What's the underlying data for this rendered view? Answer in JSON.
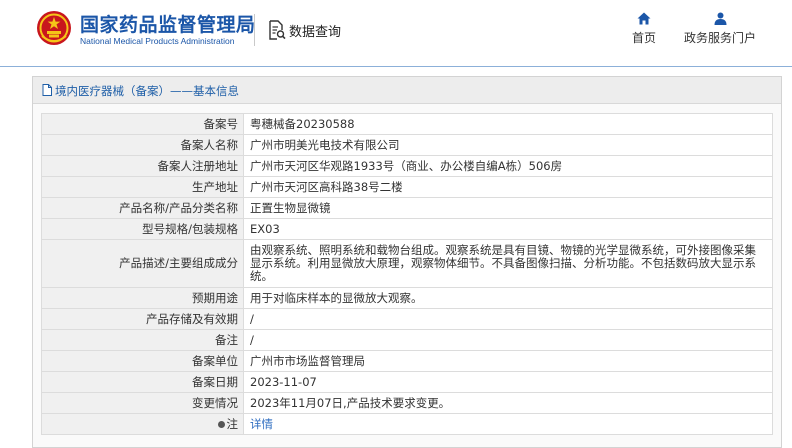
{
  "header": {
    "org_name_cn": "国家药品监督管理局",
    "org_name_en": "National Medical Products Administration",
    "data_query_label": "数据查询",
    "nav": {
      "home_label": "首页",
      "service_label": "政务服务门户"
    },
    "icons": {
      "emblem": "national-emblem-icon",
      "data_query": "document-search-icon",
      "home": "home-icon",
      "service": "user-icon"
    },
    "colors": {
      "brand_blue": "#1b56a8",
      "link_blue": "#2d6cc0"
    }
  },
  "panel": {
    "title": "境内医疗器械（备案）——基本信息",
    "title_icon": "document-icon"
  },
  "record": {
    "rows": [
      {
        "label": "备案号",
        "value": "粤穗械备20230588"
      },
      {
        "label": "备案人名称",
        "value": "广州市明美光电技术有限公司"
      },
      {
        "label": "备案人注册地址",
        "value": "广州市天河区华观路1933号（商业、办公楼自编A栋）506房"
      },
      {
        "label": "生产地址",
        "value": "广州市天河区高科路38号二楼"
      },
      {
        "label": "产品名称/产品分类名称",
        "value": "正置生物显微镜"
      },
      {
        "label": "型号规格/包装规格",
        "value": "EX03"
      },
      {
        "label": "产品描述/主要组成成分",
        "value": "由观察系统、照明系统和载物台组成。观察系统是具有目镜、物镜的光学显微系统，可外接图像采集显示系统。利用显微放大原理，观察物体细节。不具备图像扫描、分析功能。不包括数码放大显示系统。"
      },
      {
        "label": "预期用途",
        "value": "用于对临床样本的显微放大观察。"
      },
      {
        "label": "产品存储及有效期",
        "value": "/"
      },
      {
        "label": "备注",
        "value": "/"
      },
      {
        "label": "备案单位",
        "value": "广州市市场监督管理局"
      },
      {
        "label": "备案日期",
        "value": "2023-11-07"
      },
      {
        "label": "变更情况",
        "value": "2023年11月07日,产品技术要求变更。"
      },
      {
        "label": "注",
        "value": "详情"
      }
    ]
  }
}
